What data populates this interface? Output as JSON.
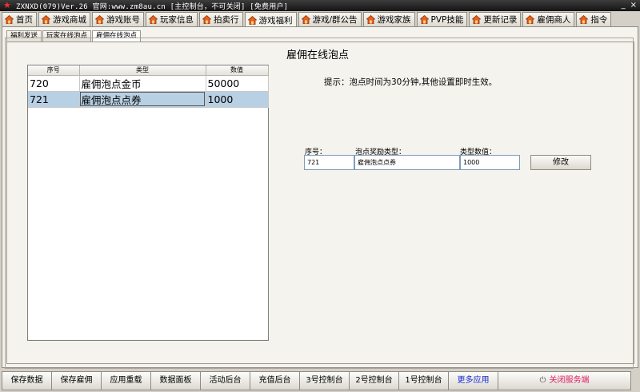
{
  "window": {
    "title": "ZXNXD(079)Ver.26 官网:www.zm8au.cn   [主控制台，不可关闭]  [免费用户]",
    "minimize_glyph": "_",
    "close_glyph": "×",
    "app_icon": "star-icon"
  },
  "main_tabs": [
    {
      "label": "首页",
      "icon": "house-icon"
    },
    {
      "label": "游戏商城",
      "icon": "house-icon"
    },
    {
      "label": "游戏账号",
      "icon": "house-icon"
    },
    {
      "label": "玩家信息",
      "icon": "house-icon"
    },
    {
      "label": "拍卖行",
      "icon": "house-icon"
    },
    {
      "label": "游戏福利",
      "icon": "house-icon",
      "active": true
    },
    {
      "label": "游戏/群公告",
      "icon": "house-icon"
    },
    {
      "label": "游戏家族",
      "icon": "house-icon"
    },
    {
      "label": "PVP技能",
      "icon": "house-icon"
    },
    {
      "label": "更新记录",
      "icon": "house-icon"
    },
    {
      "label": "雇佣商人",
      "icon": "house-icon"
    },
    {
      "label": "指令",
      "icon": "house-icon"
    }
  ],
  "sub_tabs": [
    "福利发送",
    "玩家在线泡点",
    "雇佣在线泡点"
  ],
  "group_title": "雇佣在线泡点",
  "table": {
    "columns": [
      "序号",
      "类型",
      "数值"
    ],
    "rows": [
      [
        "720",
        "雇佣泡点金币",
        "50000"
      ],
      [
        "721",
        "雇佣泡点点券",
        "1000"
      ]
    ],
    "selected_row": 1
  },
  "hint": "提示：泡点时间为30分钟,其他设置即时生效。",
  "form": {
    "id_label": "序号：",
    "type_label": "泡点奖励类型：",
    "value_label": "类型数值：",
    "id_value": "721",
    "type_value": "雇佣泡点点券",
    "value_value": "1000",
    "modify_label": "修改"
  },
  "toolbar": {
    "buttons": [
      "保存数据",
      "保存雇佣",
      "应用重载",
      "数据面板",
      "活动后台",
      "充值后台",
      "3号控制台",
      "2号控制台",
      "1号控制台",
      "更多应用"
    ],
    "close_label": "关闭服务端",
    "accent_more": "#1a2ad8",
    "accent_close": "#e0206a"
  }
}
